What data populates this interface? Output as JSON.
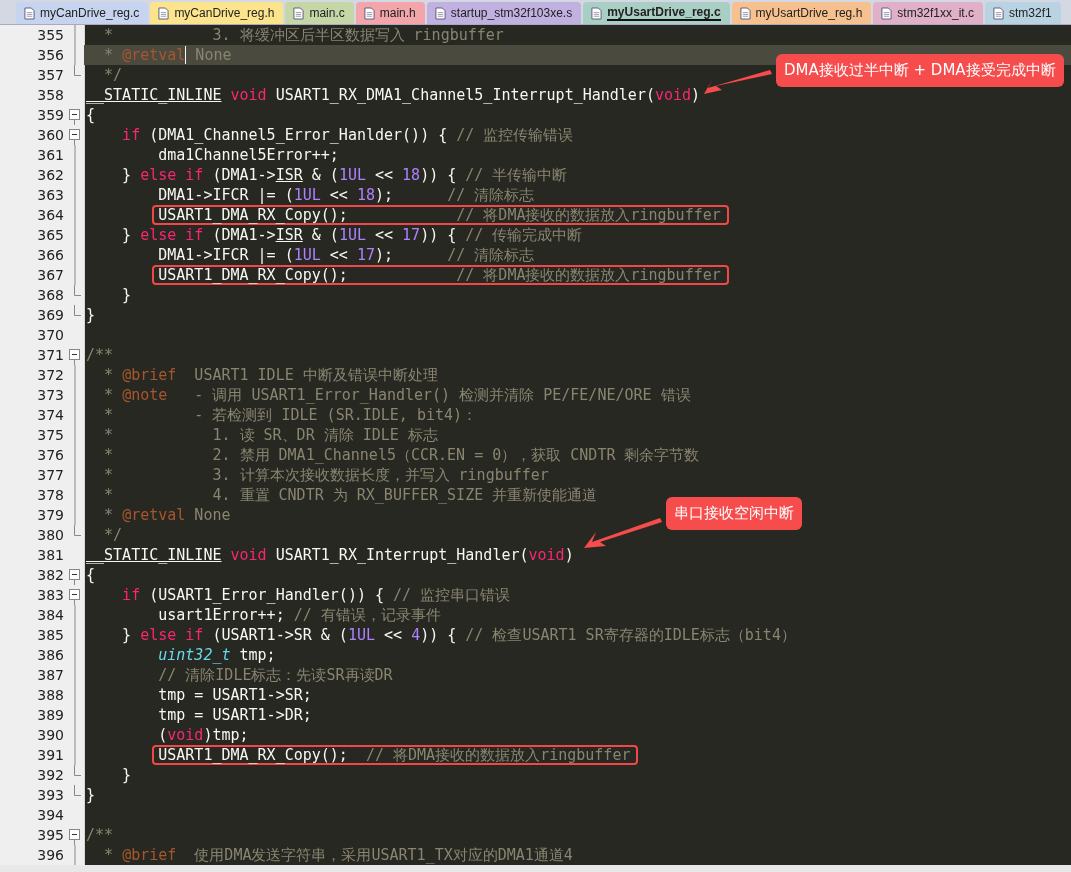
{
  "tabs": [
    {
      "label": "myCanDrive_reg.c",
      "color": "#c7d4ef",
      "selected": false
    },
    {
      "label": "myCanDrive_reg.h",
      "color": "#fbe48c",
      "selected": false
    },
    {
      "label": "main.c",
      "color": "#c5d7a7",
      "selected": false
    },
    {
      "label": "main.h",
      "color": "#f2a5aa",
      "selected": false
    },
    {
      "label": "startup_stm32f103xe.s",
      "color": "#c0b1e0",
      "selected": false
    },
    {
      "label": "myUsartDrive_reg.c",
      "color": "#a9cfc5",
      "selected": true
    },
    {
      "label": "myUsartDrive_reg.h",
      "color": "#f6c08f",
      "selected": false
    },
    {
      "label": "stm32f1xx_it.c",
      "color": "#e0b0c8",
      "selected": false
    },
    {
      "label": "stm32f1",
      "color": "#b9d3e3",
      "selected": false
    }
  ],
  "lines": [
    {
      "n": "355",
      "fold": {
        "kind": "line"
      },
      "tokens": [
        {
          "kind": "comment",
          "text": "  *           3. 将缓冲区后半区数据写入 ringbuffer"
        }
      ]
    },
    {
      "n": "356",
      "fold": {
        "kind": "line"
      },
      "current": true,
      "tokens": [
        {
          "kind": "comment",
          "text": "  * "
        },
        {
          "kind": "doctag",
          "text": "@retval",
          "caret": true
        },
        {
          "kind": "comment",
          "text": " None"
        }
      ]
    },
    {
      "n": "357",
      "fold": {
        "kind": "end"
      },
      "tokens": [
        {
          "kind": "comment",
          "text": "  */"
        }
      ]
    },
    {
      "n": "358",
      "tokens": [
        {
          "kind": "macro",
          "text": "__STATIC_INLINE"
        },
        {
          "kind": "keyword",
          "text": " void"
        },
        {
          "kind": "plain",
          "text": " USART1_RX_DMA1_Channel5_Interrupt_Handler("
        },
        {
          "kind": "keyword",
          "text": "void"
        },
        {
          "kind": "plain",
          "text": ")"
        }
      ]
    },
    {
      "n": "359",
      "fold": {
        "kind": "open"
      },
      "tokens": [
        {
          "kind": "plain",
          "text": "{"
        }
      ]
    },
    {
      "n": "360",
      "fold": {
        "kind": "open"
      },
      "tokens": [
        {
          "kind": "keyword",
          "text": "    if"
        },
        {
          "kind": "plain",
          "text": " (DMA1_Channel5_Error_Hanlder()) { "
        },
        {
          "kind": "comment",
          "text": "// 监控传输错误"
        }
      ]
    },
    {
      "n": "361",
      "fold": {
        "kind": "line"
      },
      "tokens": [
        {
          "kind": "plain",
          "text": "        dma1Channel5Error++;"
        }
      ]
    },
    {
      "n": "362",
      "fold": {
        "kind": "line"
      },
      "tokens": [
        {
          "kind": "plain",
          "text": "    } "
        },
        {
          "kind": "keyword",
          "text": "else if"
        },
        {
          "kind": "plain",
          "text": " (DMA1->"
        },
        {
          "kind": "macro",
          "text": "ISR"
        },
        {
          "kind": "plain",
          "text": " & ("
        },
        {
          "kind": "number",
          "text": "1UL"
        },
        {
          "kind": "plain",
          "text": " << "
        },
        {
          "kind": "number",
          "text": "18"
        },
        {
          "kind": "plain",
          "text": ")) { "
        },
        {
          "kind": "comment",
          "text": "// 半传输中断"
        }
      ]
    },
    {
      "n": "363",
      "fold": {
        "kind": "line"
      },
      "tokens": [
        {
          "kind": "plain",
          "text": "        DMA1->IFCR |= ("
        },
        {
          "kind": "number",
          "text": "1UL"
        },
        {
          "kind": "plain",
          "text": " << "
        },
        {
          "kind": "number",
          "text": "18"
        },
        {
          "kind": "plain",
          "text": ");      "
        },
        {
          "kind": "comment",
          "text": "// 清除标志"
        }
      ]
    },
    {
      "n": "364",
      "fold": {
        "kind": "line"
      },
      "boxed": true,
      "tokens": [
        {
          "kind": "plain",
          "text": "        USART1_DMA_RX_Copy();            "
        },
        {
          "kind": "comment",
          "text": "// 将DMA接收的数据放入ringbuffer"
        }
      ]
    },
    {
      "n": "365",
      "fold": {
        "kind": "line"
      },
      "tokens": [
        {
          "kind": "plain",
          "text": "    } "
        },
        {
          "kind": "keyword",
          "text": "else if"
        },
        {
          "kind": "plain",
          "text": " (DMA1->"
        },
        {
          "kind": "macro",
          "text": "ISR"
        },
        {
          "kind": "plain",
          "text": " & ("
        },
        {
          "kind": "number",
          "text": "1UL"
        },
        {
          "kind": "plain",
          "text": " << "
        },
        {
          "kind": "number",
          "text": "17"
        },
        {
          "kind": "plain",
          "text": ")) { "
        },
        {
          "kind": "comment",
          "text": "// 传输完成中断"
        }
      ]
    },
    {
      "n": "366",
      "fold": {
        "kind": "line"
      },
      "tokens": [
        {
          "kind": "plain",
          "text": "        DMA1->IFCR |= ("
        },
        {
          "kind": "number",
          "text": "1UL"
        },
        {
          "kind": "plain",
          "text": " << "
        },
        {
          "kind": "number",
          "text": "17"
        },
        {
          "kind": "plain",
          "text": ");      "
        },
        {
          "kind": "comment",
          "text": "// 清除标志"
        }
      ]
    },
    {
      "n": "367",
      "fold": {
        "kind": "line"
      },
      "boxed": true,
      "tokens": [
        {
          "kind": "plain",
          "text": "        USART1_DMA_RX_Copy();            "
        },
        {
          "kind": "comment",
          "text": "// 将DMA接收的数据放入ringbuffer"
        }
      ]
    },
    {
      "n": "368",
      "fold": {
        "kind": "end"
      },
      "tokens": [
        {
          "kind": "plain",
          "text": "    }"
        }
      ]
    },
    {
      "n": "369",
      "fold": {
        "kind": "end"
      },
      "tokens": [
        {
          "kind": "plain",
          "text": "}"
        }
      ]
    },
    {
      "n": "370"
    },
    {
      "n": "371",
      "fold": {
        "kind": "open"
      },
      "tokens": [
        {
          "kind": "comment",
          "text": "/**"
        }
      ]
    },
    {
      "n": "372",
      "fold": {
        "kind": "line"
      },
      "tokens": [
        {
          "kind": "comment",
          "text": "  * "
        },
        {
          "kind": "doctag",
          "text": "@brief"
        },
        {
          "kind": "comment",
          "text": "  USART1 IDLE 中断及错误中断处理"
        }
      ]
    },
    {
      "n": "373",
      "fold": {
        "kind": "line"
      },
      "tokens": [
        {
          "kind": "comment",
          "text": "  * "
        },
        {
          "kind": "doctag",
          "text": "@note"
        },
        {
          "kind": "comment",
          "text": "   - 调用 USART1_Error_Handler() 检测并清除 PE/FE/NE/ORE 错误"
        }
      ]
    },
    {
      "n": "374",
      "fold": {
        "kind": "line"
      },
      "tokens": [
        {
          "kind": "comment",
          "text": "  *         - 若检测到 IDLE (SR.IDLE, bit4)："
        }
      ]
    },
    {
      "n": "375",
      "fold": {
        "kind": "line"
      },
      "tokens": [
        {
          "kind": "comment",
          "text": "  *           1. 读 SR、DR 清除 IDLE 标志"
        }
      ]
    },
    {
      "n": "376",
      "fold": {
        "kind": "line"
      },
      "tokens": [
        {
          "kind": "comment",
          "text": "  *           2. 禁用 DMA1_Channel5（CCR.EN = 0），获取 CNDTR 剩余字节数"
        }
      ]
    },
    {
      "n": "377",
      "fold": {
        "kind": "line"
      },
      "tokens": [
        {
          "kind": "comment",
          "text": "  *           3. 计算本次接收数据长度，并写入 ringbuffer"
        }
      ]
    },
    {
      "n": "378",
      "fold": {
        "kind": "line"
      },
      "tokens": [
        {
          "kind": "comment",
          "text": "  *           4. 重置 CNDTR 为 RX_BUFFER_SIZE 并重新使能通道"
        }
      ]
    },
    {
      "n": "379",
      "fold": {
        "kind": "line"
      },
      "tokens": [
        {
          "kind": "comment",
          "text": "  * "
        },
        {
          "kind": "doctag",
          "text": "@retval"
        },
        {
          "kind": "comment",
          "text": " None"
        }
      ]
    },
    {
      "n": "380",
      "fold": {
        "kind": "end"
      },
      "tokens": [
        {
          "kind": "comment",
          "text": "  */"
        }
      ]
    },
    {
      "n": "381",
      "tokens": [
        {
          "kind": "macro",
          "text": "__STATIC_INLINE"
        },
        {
          "kind": "keyword",
          "text": " void"
        },
        {
          "kind": "plain",
          "text": " USART1_RX_Interrupt_Handler("
        },
        {
          "kind": "keyword",
          "text": "void"
        },
        {
          "kind": "plain",
          "text": ")"
        }
      ]
    },
    {
      "n": "382",
      "fold": {
        "kind": "open"
      },
      "tokens": [
        {
          "kind": "plain",
          "text": "{"
        }
      ]
    },
    {
      "n": "383",
      "fold": {
        "kind": "open"
      },
      "tokens": [
        {
          "kind": "keyword",
          "text": "    if"
        },
        {
          "kind": "plain",
          "text": " (USART1_Error_Handler()) { "
        },
        {
          "kind": "comment",
          "text": "// 监控串口错误"
        }
      ]
    },
    {
      "n": "384",
      "fold": {
        "kind": "line"
      },
      "tokens": [
        {
          "kind": "plain",
          "text": "        usart1Error++; "
        },
        {
          "kind": "comment",
          "text": "// 有错误，记录事件"
        }
      ]
    },
    {
      "n": "385",
      "fold": {
        "kind": "line"
      },
      "tokens": [
        {
          "kind": "plain",
          "text": "    } "
        },
        {
          "kind": "keyword",
          "text": "else if"
        },
        {
          "kind": "plain",
          "text": " (USART1->SR & ("
        },
        {
          "kind": "number",
          "text": "1UL"
        },
        {
          "kind": "plain",
          "text": " << "
        },
        {
          "kind": "number",
          "text": "4"
        },
        {
          "kind": "plain",
          "text": ")) { "
        },
        {
          "kind": "comment",
          "text": "// 检查USART1 SR寄存器的IDLE标志（bit4）"
        }
      ]
    },
    {
      "n": "386",
      "fold": {
        "kind": "line"
      },
      "tokens": [
        {
          "kind": "type",
          "text": "        uint32_t"
        },
        {
          "kind": "plain",
          "text": " tmp;"
        }
      ]
    },
    {
      "n": "387",
      "fold": {
        "kind": "line"
      },
      "tokens": [
        {
          "kind": "comment",
          "text": "        // 清除IDLE标志：先读SR再读DR"
        }
      ]
    },
    {
      "n": "388",
      "fold": {
        "kind": "line"
      },
      "tokens": [
        {
          "kind": "plain",
          "text": "        tmp = USART1->SR;"
        }
      ]
    },
    {
      "n": "389",
      "fold": {
        "kind": "line"
      },
      "tokens": [
        {
          "kind": "plain",
          "text": "        tmp = USART1->DR;"
        }
      ]
    },
    {
      "n": "390",
      "fold": {
        "kind": "line"
      },
      "tokens": [
        {
          "kind": "plain",
          "text": "        ("
        },
        {
          "kind": "keyword",
          "text": "void"
        },
        {
          "kind": "plain",
          "text": ")tmp;"
        }
      ]
    },
    {
      "n": "391",
      "fold": {
        "kind": "line"
      },
      "boxed": true,
      "tokens": [
        {
          "kind": "plain",
          "text": "        USART1_DMA_RX_Copy();  "
        },
        {
          "kind": "comment",
          "text": "// 将DMA接收的数据放入ringbuffer"
        }
      ]
    },
    {
      "n": "392",
      "fold": {
        "kind": "end"
      },
      "tokens": [
        {
          "kind": "plain",
          "text": "    }"
        }
      ]
    },
    {
      "n": "393",
      "fold": {
        "kind": "end"
      },
      "tokens": [
        {
          "kind": "plain",
          "text": "}"
        }
      ]
    },
    {
      "n": "394"
    },
    {
      "n": "395",
      "fold": {
        "kind": "open"
      },
      "tokens": [
        {
          "kind": "comment",
          "text": "/**"
        }
      ]
    },
    {
      "n": "396",
      "fold": {
        "kind": "line"
      },
      "tokens": [
        {
          "kind": "comment",
          "text": "  * "
        },
        {
          "kind": "doctag",
          "text": "@brief"
        },
        {
          "kind": "comment",
          "text": "  使用DMA发送字符串，采用USART1_TX对应的DMA1通道4"
        }
      ]
    }
  ],
  "callouts": [
    {
      "text": "DMA接收过半中断 + DMA接受完成中断"
    },
    {
      "text": "串口接收空闲中断"
    }
  ]
}
